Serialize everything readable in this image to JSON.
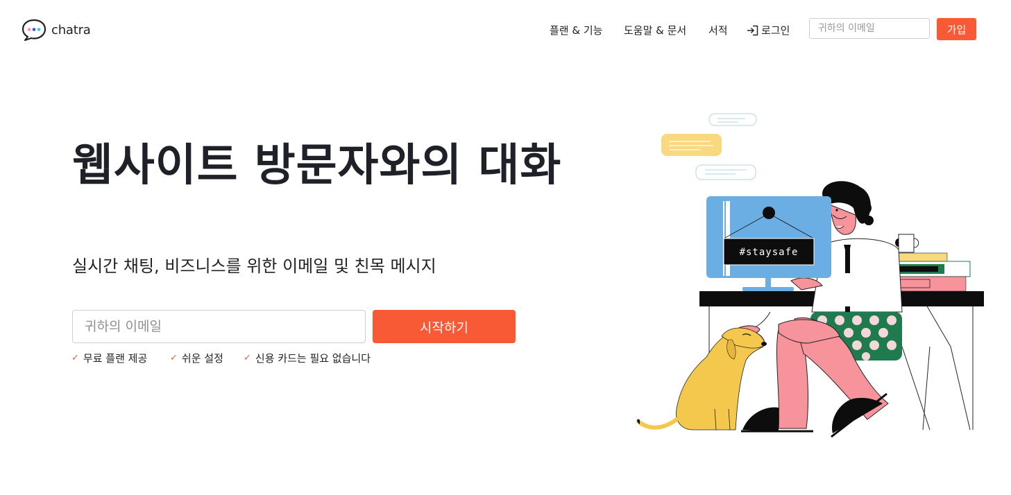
{
  "header": {
    "logo_text": "chatra",
    "nav": {
      "plans": "플랜 & 기능",
      "help": "도움말 & 문서",
      "books": "서적",
      "login": "로그인"
    },
    "email_placeholder": "귀하의 이메일",
    "signup_label": "가입"
  },
  "hero": {
    "title": "웹사이트 방문자와의 대화",
    "subtitle": "실시간 채팅, 비즈니스를 위한 이메일 및 친목 메시지",
    "email_placeholder": "귀하의 이메일",
    "cta_label": "시작하기",
    "features": [
      "무료 플랜 제공",
      "쉬운 설정",
      "신용 카드는 필요 없습니다"
    ]
  },
  "illustration": {
    "sign_text": "#staysafe"
  },
  "colors": {
    "accent": "#f95a36",
    "title_text": "#1e2127",
    "monitor_blue": "#6aaee3",
    "pants_pink": "#f7939a",
    "dog_yellow": "#f4c84c",
    "bubble_yellow": "#f9d97f",
    "shirt_green": "#1f7a4d"
  },
  "icons": {
    "logo": "chat-bubble-logo-icon",
    "login": "login-arrow-icon",
    "feature_check": "check-icon"
  }
}
